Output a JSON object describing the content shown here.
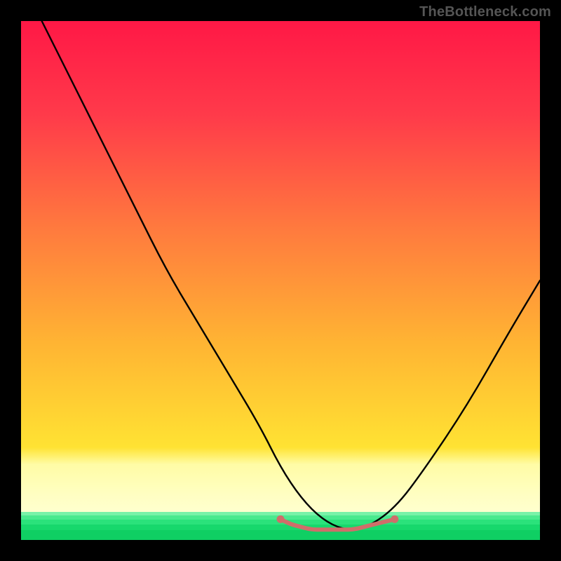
{
  "watermark": "TheBottleneck.com",
  "chart_data": {
    "type": "line",
    "title": "",
    "xlabel": "",
    "ylabel": "",
    "xlim": [
      0,
      100
    ],
    "ylim": [
      0,
      100
    ],
    "background_gradient": {
      "top": "#ff1846",
      "mid": "#ffd400",
      "bottom_band_top": "#ffffa8",
      "green": "#2be27b"
    },
    "series": [
      {
        "name": "curve-main",
        "color": "#000000",
        "x": [
          4,
          10,
          16,
          22,
          28,
          34,
          40,
          46,
          50,
          54,
          58,
          62,
          66,
          72,
          78,
          86,
          94,
          100
        ],
        "y": [
          100,
          88,
          76,
          64,
          52,
          42,
          32,
          22,
          14,
          8,
          4,
          2,
          2,
          6,
          14,
          26,
          40,
          50
        ]
      },
      {
        "name": "highlight-band",
        "color": "#cf6e6a",
        "x": [
          50,
          52,
          54,
          56,
          58,
          60,
          62,
          64,
          66,
          68,
          70,
          72
        ],
        "y": [
          4,
          3,
          2.5,
          2,
          2,
          2,
          2,
          2,
          2.5,
          3,
          3.5,
          4
        ]
      }
    ],
    "highlight_dots": {
      "color": "#cf6e6a",
      "points": [
        {
          "x": 50,
          "y": 4
        },
        {
          "x": 72,
          "y": 4
        }
      ]
    }
  }
}
